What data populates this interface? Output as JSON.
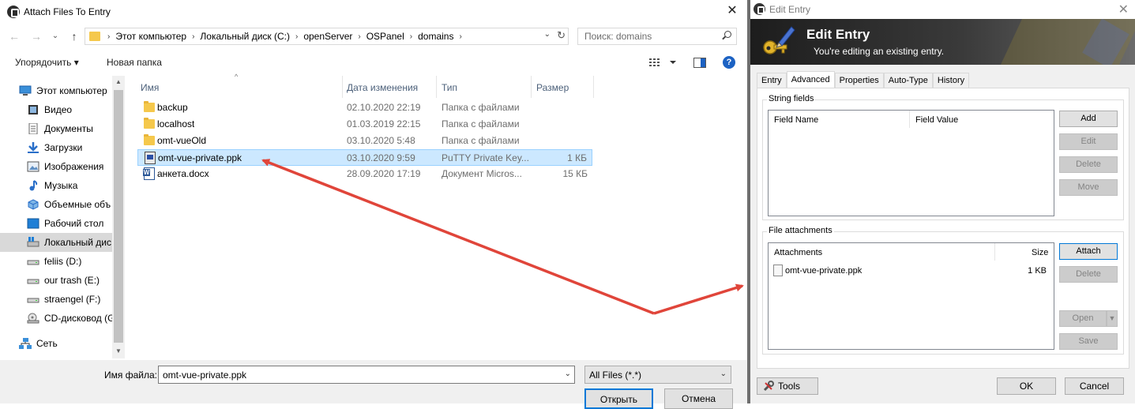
{
  "left_window": {
    "title": "Attach Files To Entry",
    "nav": {
      "back": "←",
      "forward": "→",
      "recent": "⌄",
      "up": "↑",
      "breadcrumbs": [
        "Этот компьютер",
        "Локальный диск (C:)",
        "openServer",
        "OSPanel",
        "domains"
      ],
      "search_placeholder": "Поиск: domains"
    },
    "commands": {
      "organize": "Упорядочить ▾",
      "new_folder": "Новая папка"
    },
    "sidebar": {
      "items": [
        {
          "label": "Этот компьютер",
          "icon": "computer-icon"
        },
        {
          "label": "Видео",
          "icon": "video-icon"
        },
        {
          "label": "Документы",
          "icon": "documents-icon"
        },
        {
          "label": "Загрузки",
          "icon": "downloads-icon"
        },
        {
          "label": "Изображения",
          "icon": "pictures-icon"
        },
        {
          "label": "Музыка",
          "icon": "music-icon"
        },
        {
          "label": "Объемные объ",
          "icon": "3d-objects-icon"
        },
        {
          "label": "Рабочий стол",
          "icon": "desktop-icon"
        },
        {
          "label": "Локальный дис",
          "icon": "local-disk-icon",
          "selected": true
        },
        {
          "label": "feliis (D:)",
          "icon": "drive-icon"
        },
        {
          "label": "our trash (E:)",
          "icon": "drive-icon"
        },
        {
          "label": "straengel (F:)",
          "icon": "drive-icon"
        },
        {
          "label": "CD-дисковод (G",
          "icon": "cd-drive-icon"
        },
        {
          "label": "Сеть",
          "icon": "network-icon"
        }
      ]
    },
    "columns": {
      "name": "Имя",
      "date": "Дата изменения",
      "type": "Тип",
      "size": "Размер"
    },
    "files": [
      {
        "name": "backup",
        "date": "02.10.2020 22:19",
        "type": "Папка с файлами",
        "size": "",
        "icon": "folder"
      },
      {
        "name": "localhost",
        "date": "01.03.2019 22:15",
        "type": "Папка с файлами",
        "size": "",
        "icon": "folder"
      },
      {
        "name": "omt-vueOld",
        "date": "03.10.2020 5:48",
        "type": "Папка с файлами",
        "size": "",
        "icon": "folder"
      },
      {
        "name": "omt-vue-private.ppk",
        "date": "03.10.2020 9:59",
        "type": "PuTTY Private Key...",
        "size": "1 КБ",
        "icon": "ppk",
        "selected": true
      },
      {
        "name": "анкета.docx",
        "date": "28.09.2020 17:19",
        "type": "Документ Micros...",
        "size": "15 КБ",
        "icon": "docx"
      }
    ],
    "bottom": {
      "filename_label": "Имя файла:",
      "filename_value": "omt-vue-private.ppk",
      "filter": "All Files (*.*)",
      "open": "Открыть",
      "cancel": "Отмена"
    }
  },
  "right_window": {
    "title": "Edit Entry",
    "banner_title": "Edit Entry",
    "banner_subtitle": "You're editing an existing entry.",
    "tabs": [
      "Entry",
      "Advanced",
      "Properties",
      "Auto-Type",
      "History"
    ],
    "active_tab": "Advanced",
    "string_fields": {
      "label": "String fields",
      "col_name": "Field Name",
      "col_value": "Field Value",
      "buttons": {
        "add": "Add",
        "edit": "Edit",
        "delete": "Delete",
        "move": "Move"
      }
    },
    "attachments": {
      "label": "File attachments",
      "col_name": "Attachments",
      "col_size": "Size",
      "item_name": "omt-vue-private.ppk",
      "item_size": "1 KB",
      "buttons": {
        "attach": "Attach",
        "delete": "Delete",
        "open": "Open",
        "save": "Save"
      }
    },
    "bottom": {
      "tools": "Tools",
      "ok": "OK",
      "cancel": "Cancel"
    }
  },
  "colors": {
    "annotation_arrow": "#e0453a",
    "selection": "#cce8ff",
    "accent": "#0078d7"
  }
}
